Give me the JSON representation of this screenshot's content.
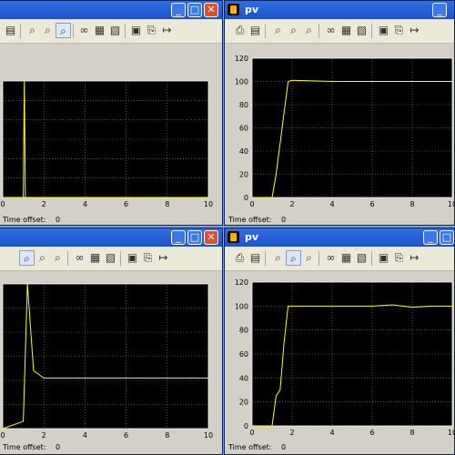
{
  "windows": [
    {
      "title": "",
      "time_offset_label": "Time offset:",
      "time_offset_value": "0",
      "xticks": [
        "0",
        "2",
        "4",
        "6",
        "8",
        "10"
      ],
      "yticks": [],
      "toolbar": [
        "page-icon",
        "zoom-in-icon",
        "zoom-x-icon",
        "zoom-y-icon",
        "binoculars-icon",
        "axes-icon",
        "restore-icon",
        "params-icon",
        "float-icon",
        "lock-icon"
      ]
    },
    {
      "title": "pv",
      "time_offset_label": "Time offset:",
      "time_offset_value": "0",
      "xticks": [
        "0",
        "2",
        "4",
        "6",
        "8",
        "10"
      ],
      "yticks": [
        "0",
        "20",
        "40",
        "60",
        "80",
        "100",
        "120"
      ],
      "toolbar": [
        "print-icon",
        "params-icon",
        "zoom-in-icon",
        "zoom-x-icon",
        "zoom-y-icon",
        "binoculars-icon",
        "axes-icon",
        "restore-icon",
        "save-icon",
        "float-icon",
        "lock-icon"
      ]
    },
    {
      "title": "",
      "time_offset_label": "Time offset:",
      "time_offset_value": "0",
      "xticks": [
        "0",
        "2",
        "4",
        "6",
        "8",
        "10"
      ],
      "yticks": [],
      "toolbar": [
        "zoom-in-icon",
        "zoom-x-icon",
        "zoom-y-icon",
        "binoculars-icon",
        "axes-icon",
        "restore-icon",
        "params-icon",
        "float-icon",
        "lock-icon"
      ]
    },
    {
      "title": "pv",
      "time_offset_label": "Time offset:",
      "time_offset_value": "0",
      "xticks": [
        "0",
        "2",
        "4",
        "6",
        "8",
        "10"
      ],
      "yticks": [
        "0",
        "20",
        "40",
        "60",
        "80",
        "100",
        "120"
      ],
      "toolbar": [
        "print-icon",
        "params-icon",
        "zoom-in-icon",
        "zoom-x-icon",
        "zoom-y-icon",
        "binoculars-icon",
        "axes-icon",
        "restore-icon",
        "save-icon",
        "float-icon",
        "lock-icon"
      ]
    }
  ],
  "colors": {
    "trace": "#ffff00",
    "grid": "#8a8a8a",
    "axes": "#ffffff",
    "plot_bg": "#000000"
  },
  "chart_data": [
    {
      "type": "line",
      "xlim": [
        0,
        10
      ],
      "grid": true,
      "series": [
        {
          "x": [
            0,
            1,
            1.05,
            1.1,
            10
          ],
          "y": [
            0,
            0,
            100,
            0,
            0
          ]
        }
      ]
    },
    {
      "type": "line",
      "xlim": [
        0,
        10
      ],
      "ylim": [
        0,
        120
      ],
      "grid": true,
      "series": [
        {
          "x": [
            0,
            0.5,
            1.0,
            1.2,
            1.5,
            1.8,
            2,
            4,
            6,
            8,
            10
          ],
          "y": [
            0,
            0,
            0,
            20,
            60,
            100,
            101,
            100,
            100,
            100,
            100
          ]
        }
      ]
    },
    {
      "type": "line",
      "xlim": [
        0,
        10
      ],
      "grid": true,
      "series": [
        {
          "x": [
            0,
            1,
            1.2,
            1.5,
            2,
            4,
            6,
            8,
            10
          ],
          "y": [
            0,
            5,
            100,
            40,
            35,
            35,
            35,
            35,
            35
          ]
        }
      ]
    },
    {
      "type": "line",
      "xlim": [
        0,
        10
      ],
      "ylim": [
        0,
        120
      ],
      "grid": true,
      "series": [
        {
          "x": [
            0,
            0.5,
            1.0,
            1.2,
            1.4,
            1.6,
            1.8,
            2,
            4,
            6,
            7,
            8,
            9,
            10
          ],
          "y": [
            0,
            0,
            0,
            25,
            30,
            70,
            100,
            100,
            100,
            100,
            101,
            99,
            100,
            100
          ]
        }
      ]
    }
  ]
}
